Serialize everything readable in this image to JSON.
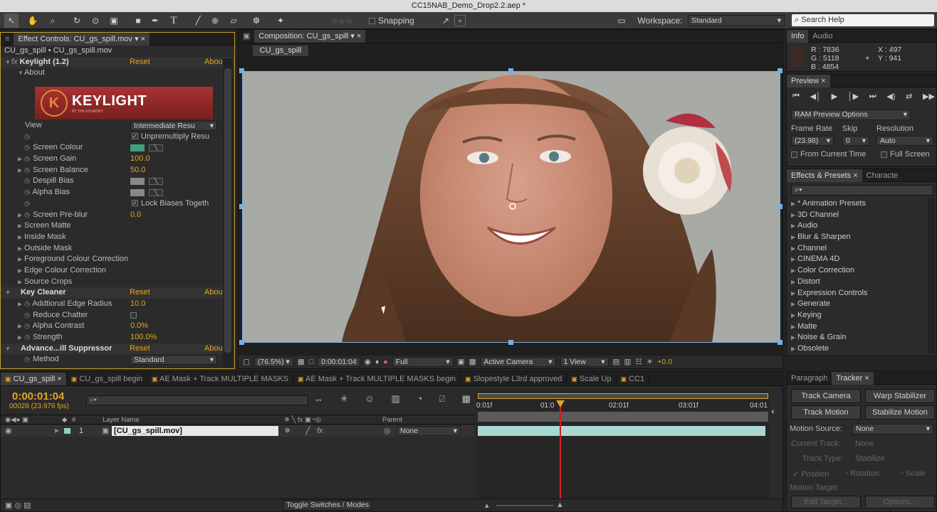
{
  "window_title": "CC15NAB_Demo_Drop2.2.aep *",
  "toolbar": {
    "snapping": "Snapping",
    "workspace_label": "Workspace:",
    "workspace_value": "Standard",
    "search_placeholder": "Search Help"
  },
  "effect_controls": {
    "tab": "Effect Controls: CU_gs_spill.mov",
    "breadcrumb": "CU_gs_spill • CU_gs_spill.mov",
    "effect_name": "Keylight (1.2)",
    "reset": "Reset",
    "about": "Abou",
    "about_row": "About",
    "logo_text": "KEYLIGHT",
    "logo_sub": "BY THE FOUNDRY",
    "rows": [
      {
        "label": "View",
        "value": "Intermediate Resu",
        "kind": "dropdown"
      },
      {
        "label": "",
        "value": "Unpremultiply Resu",
        "kind": "check"
      },
      {
        "label": "Screen Colour",
        "value": "",
        "kind": "color"
      },
      {
        "label": "Screen Gain",
        "value": "100.0",
        "kind": "num",
        "tri": true
      },
      {
        "label": "Screen Balance",
        "value": "50.0",
        "kind": "num",
        "tri": true
      },
      {
        "label": "Despill Bias",
        "value": "",
        "kind": "color2"
      },
      {
        "label": "Alpha Bias",
        "value": "",
        "kind": "color2"
      },
      {
        "label": "",
        "value": "Lock Biases Togeth",
        "kind": "check"
      },
      {
        "label": "Screen Pre-blur",
        "value": "0.0",
        "kind": "num",
        "tri": true
      },
      {
        "label": "Screen Matte",
        "value": "",
        "kind": "group"
      },
      {
        "label": "Inside Mask",
        "value": "",
        "kind": "group"
      },
      {
        "label": "Outside Mask",
        "value": "",
        "kind": "group"
      },
      {
        "label": "Foreground Colour Correction",
        "value": "",
        "kind": "group"
      },
      {
        "label": "Edge Colour Correction",
        "value": "",
        "kind": "group"
      },
      {
        "label": "Source Crops",
        "value": "",
        "kind": "group"
      }
    ],
    "key_cleaner": "Key Cleaner",
    "kc_rows": [
      {
        "label": "Addtional Edge Radius",
        "value": "10.0"
      },
      {
        "label": "Reduce Chatter",
        "value": ""
      },
      {
        "label": "Alpha Contrast",
        "value": "0.0%"
      },
      {
        "label": "Strength",
        "value": "100.0%"
      }
    ],
    "advanced": "Advance...ill Suppressor",
    "method_label": "Method",
    "method_value": "Standard"
  },
  "composition": {
    "tab": "Composition: CU_gs_spill",
    "subtab": "CU_gs_spill",
    "zoom": "(76.5%)",
    "timecode": "0:00:01:04",
    "resolution": "Full",
    "camera": "Active Camera",
    "views": "1 View",
    "exposure": "+0.0"
  },
  "info": {
    "tabs": [
      "Info",
      "Audio"
    ],
    "r": "R : 7836",
    "g": "G : 5118",
    "b": "B : 4854",
    "x": "X : 497",
    "y": "Y : 941",
    "swatch": "#3e2a22"
  },
  "preview": {
    "tab": "Preview",
    "ram": "RAM Preview Options",
    "frame_rate_label": "Frame Rate",
    "skip_label": "Skip",
    "resolution_label": "Resolution",
    "frame_rate": "(23.98)",
    "skip": "0",
    "resolution": "Auto",
    "from_current": "From Current Time",
    "full_screen": "Full Screen"
  },
  "effects_presets": {
    "tabs": [
      "Effects & Presets",
      "Characte"
    ],
    "search": "⌕▾",
    "items": [
      "* Animation Presets",
      "3D Channel",
      "Audio",
      "Blur & Sharpen",
      "Channel",
      "CINEMA 4D",
      "Color Correction",
      "Distort",
      "Expression Controls",
      "Generate",
      "Keying",
      "Matte",
      "Noise & Grain",
      "Obsolete"
    ]
  },
  "tracker": {
    "tabs": [
      "Paragraph",
      "Tracker"
    ],
    "track_camera": "Track Camera",
    "warp_stabilizer": "Warp Stabilizer",
    "track_motion": "Track Motion",
    "stabilize_motion": "Stabilize Motion",
    "motion_source_label": "Motion Source:",
    "motion_source": "None",
    "current_track_label": "Current Track:",
    "current_track": "None",
    "track_type_label": "Track Type:",
    "track_type": "Stabilize",
    "position": "Position",
    "rotation": "Rotation",
    "scale": "Scale",
    "motion_target": "Motion Target:",
    "edit_target": "Edit Target...",
    "options": "Options..."
  },
  "timeline": {
    "tabs": [
      "CU_gs_spill",
      "CU_gs_spill begin",
      "AE Mask + Track MULTIPLE MASKS",
      "AE Mask + Track MULTIPLE MASKS begin",
      "Slopestyle L3rd approved",
      "Scale Up",
      "CC1"
    ],
    "timecode": "0:00:01:04",
    "frames": "00028 (23.976 fps)",
    "layer_name_header": "Layer Name",
    "parent_header": "Parent",
    "layer_number": "1",
    "layer_name": "[CU_gs_spill.mov]",
    "parent_value": "None",
    "ruler": [
      "0:01f",
      "01:0",
      "02:01f",
      "03:01f",
      "04:01"
    ],
    "toggle": "Toggle Switches / Modes"
  }
}
